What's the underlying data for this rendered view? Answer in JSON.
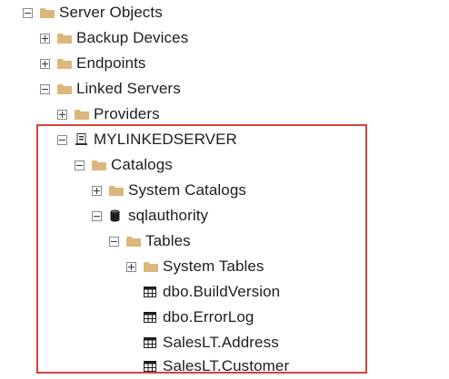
{
  "tree": {
    "server_objects": "Server Objects",
    "backup_devices": "Backup Devices",
    "endpoints": "Endpoints",
    "linked_servers": "Linked Servers",
    "providers": "Providers",
    "mylinkedserver": "MYLINKEDSERVER",
    "catalogs": "Catalogs",
    "system_catalogs": "System Catalogs",
    "sqlauthority": "sqlauthority",
    "tables": "Tables",
    "system_tables": "System Tables",
    "build_version": "dbo.BuildVersion",
    "error_log": "dbo.ErrorLog",
    "address": "SalesLT.Address",
    "customer": "SalesLT.Customer"
  },
  "colors": {
    "folder": "#dcb67a",
    "highlight": "#d9413f"
  },
  "icons": {
    "folder": "folder-icon",
    "server": "server-icon",
    "database": "database-icon",
    "table": "table-icon"
  }
}
